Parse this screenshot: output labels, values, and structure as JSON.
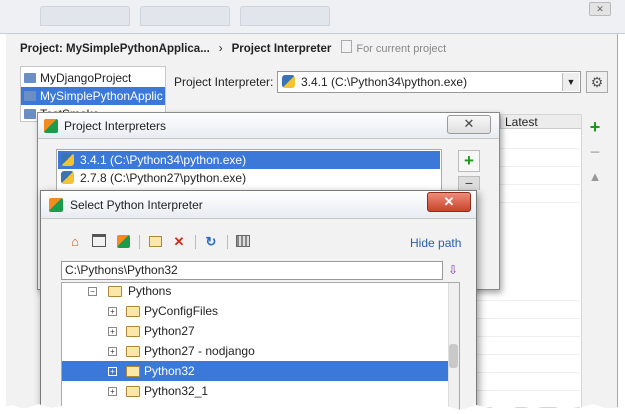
{
  "header": {
    "project": "Project: MySimplePythonApplica...",
    "separator": "›",
    "page": "Project Interpreter",
    "note": "For current project"
  },
  "projects": [
    {
      "label": "MyDjangoProject",
      "selected": false
    },
    {
      "label": "MySimplePythonApplic",
      "selected": true
    },
    {
      "label": "TestSmoke",
      "selected": false
    }
  ],
  "interpreter": {
    "label": "Project Interpreter:",
    "value": "3.4.1 (C:\\Python34\\python.exe)"
  },
  "packages": {
    "column_latest": "Latest"
  },
  "dialog_interpreters": {
    "title": "Project Interpreters",
    "items": [
      {
        "label": "3.4.1 (C:\\Python34\\python.exe)",
        "selected": true
      },
      {
        "label": "2.7.8 (C:\\Python27\\python.exe)",
        "selected": false
      }
    ],
    "add": "+",
    "remove": "−"
  },
  "dialog_select": {
    "title": "Select Python Interpreter",
    "hide_path": "Hide path",
    "path": "C:\\Pythons\\Python32",
    "tree": [
      {
        "label": "Pythons",
        "level": 1,
        "expanded": true,
        "selected": false
      },
      {
        "label": "PyConfigFiles",
        "level": 2,
        "expanded": false,
        "selected": false
      },
      {
        "label": "Python27",
        "level": 2,
        "expanded": false,
        "selected": false
      },
      {
        "label": "Python27 - nodjango",
        "level": 2,
        "expanded": false,
        "selected": false
      },
      {
        "label": "Python32",
        "level": 2,
        "expanded": false,
        "selected": true
      },
      {
        "label": "Python32_1",
        "level": 2,
        "expanded": false,
        "selected": false
      }
    ]
  },
  "icons": {
    "home": "home-icon",
    "desktop": "desktop-icon",
    "project": "pycharm-icon",
    "new_folder": "new-folder-icon",
    "delete": "delete-icon",
    "refresh": "refresh-icon",
    "show_hidden": "show-hidden-icon",
    "gear": "gear-icon"
  },
  "colors": {
    "selection": "#3b78d8",
    "link": "#2a5db0",
    "add_green": "#1a9a1a",
    "close_red": "#c9442b"
  }
}
